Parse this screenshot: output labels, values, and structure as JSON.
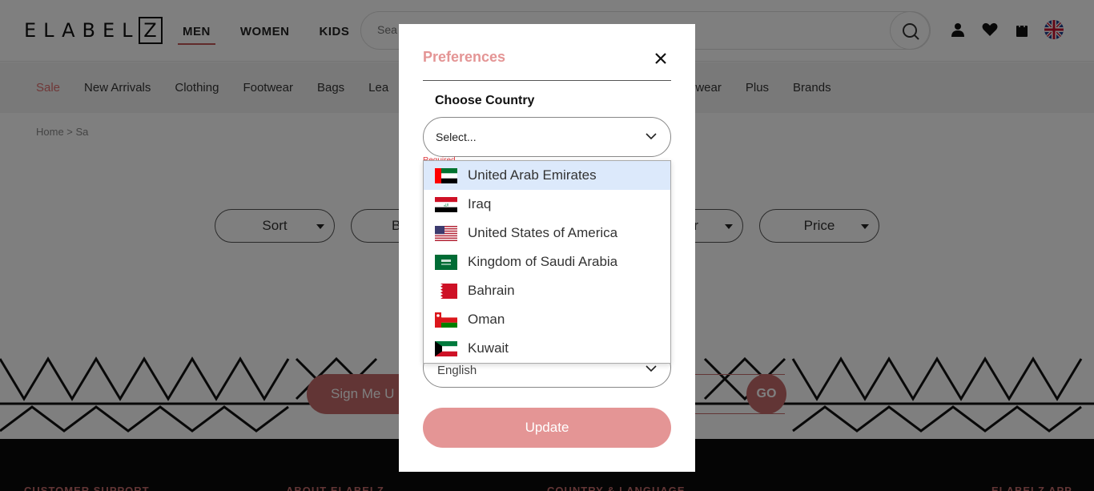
{
  "header": {
    "logo_text": "ELABEL",
    "logo_z": "Z",
    "gender_tabs": [
      {
        "label": "MEN",
        "active": true
      },
      {
        "label": "WOMEN",
        "active": false
      },
      {
        "label": "KIDS",
        "active": false
      }
    ],
    "search_placeholder": "Sea",
    "icons": [
      "search-icon",
      "user-icon",
      "heart-icon",
      "bag-icon",
      "uk-flag-icon"
    ]
  },
  "category_nav": {
    "left": [
      "Sale",
      "New Arrivals",
      "Clothing",
      "Footwear",
      "Bags",
      "Lea"
    ],
    "right": [
      "ewear",
      "Plus",
      "Brands"
    ]
  },
  "breadcrumb": "Home  >  Sa",
  "filters": {
    "sort": "Sort",
    "brand": "B",
    "color": "r",
    "price": "Price"
  },
  "newsletter": {
    "button": "Sign Me U",
    "go": "GO"
  },
  "footer": {
    "col1": "CUSTOMER SUPPORT",
    "col2": "ABOUT ELABELZ",
    "col3": "COUNTRY & LANGUAGE",
    "col4": "ELABELZ APP"
  },
  "modal": {
    "title": "Preferences",
    "choose_country_label": "Choose Country",
    "country_placeholder": "Select...",
    "required_text": "Required",
    "language_value": "English",
    "update_label": "Update"
  },
  "country_options": [
    {
      "label": "United Arab Emirates",
      "flag": "uae-flag-icon",
      "highlighted": true
    },
    {
      "label": "Iraq",
      "flag": "iraq-flag-icon",
      "highlighted": false
    },
    {
      "label": "United States of America",
      "flag": "usa-flag-icon",
      "highlighted": false
    },
    {
      "label": "Kingdom of Saudi Arabia",
      "flag": "saudi-flag-icon",
      "highlighted": false
    },
    {
      "label": "Bahrain",
      "flag": "bahrain-flag-icon",
      "highlighted": false
    },
    {
      "label": "Oman",
      "flag": "oman-flag-icon",
      "highlighted": false
    },
    {
      "label": "Kuwait",
      "flag": "kuwait-flag-icon",
      "highlighted": false
    }
  ],
  "colors": {
    "accent": "#e49595",
    "highlight": "#dce9fb",
    "overlay": "rgba(0,0,0,0.5)"
  }
}
